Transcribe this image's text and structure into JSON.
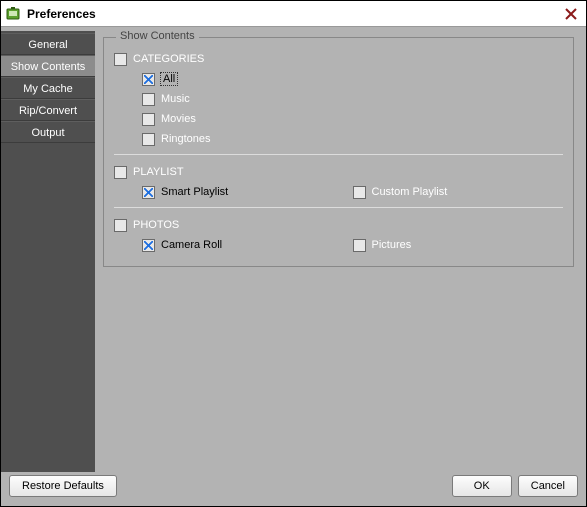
{
  "window": {
    "title": "Preferences"
  },
  "sidebar": {
    "tabs": [
      {
        "label": "General"
      },
      {
        "label": "Show Contents"
      },
      {
        "label": "My Cache"
      },
      {
        "label": "Rip/Convert"
      },
      {
        "label": "Output"
      }
    ]
  },
  "content": {
    "groupTitle": "Show Contents",
    "categories": {
      "label": "CATEGORIES",
      "all": "All",
      "music": "Music",
      "movies": "Movies",
      "ringtones": "Ringtones"
    },
    "playlist": {
      "label": "PLAYLIST",
      "smart": "Smart Playlist",
      "custom": "Custom Playlist"
    },
    "photos": {
      "label": "PHOTOS",
      "cameraRoll": "Camera Roll",
      "pictures": "Pictures"
    }
  },
  "footer": {
    "restore": "Restore Defaults",
    "ok": "OK",
    "cancel": "Cancel"
  }
}
